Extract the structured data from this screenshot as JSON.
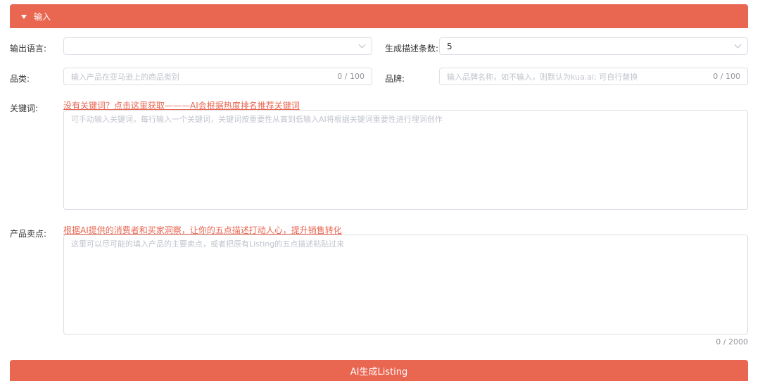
{
  "colors": {
    "accent": "#e96651",
    "border": "#dcdfe6",
    "placeholder": "#c0c4cc"
  },
  "section": {
    "title": "输入",
    "toggle_icon": "caret-down-icon"
  },
  "output_language": {
    "label": "输出语言:",
    "value": "",
    "icon": "chevron-down-icon"
  },
  "description_count": {
    "label": "生成描述条数:",
    "value": "5",
    "icon": "chevron-down-icon"
  },
  "category": {
    "label": "品类:",
    "placeholder": "输入产品在亚马逊上的商品类别",
    "count": "0 / 100"
  },
  "brand": {
    "label": "品牌:",
    "placeholder": "输入品牌名称，如不输入，则默认为kua.ai; 可自行替换",
    "count": "0 / 100"
  },
  "keywords": {
    "label": "关键词:",
    "hint_link": "没有关键词？点击这里获取———AI会根据热度排名推荐关键词",
    "placeholder": "可手动输入关键词，每行输入一个关键词，关键词按重要性从高到低输入AI将根据关键词重要性进行埋词创作"
  },
  "selling_points": {
    "label": "产品卖点:",
    "hint_link": "根据AI提供的消费者和买家洞察，让你的五点描述打动人心，提升销售转化",
    "placeholder": "这里可以尽可能的填入产品的主要卖点，或者把原有Listing的五点描述粘贴过来",
    "count": "0 / 2000"
  },
  "submit": {
    "label": "AI生成Listing"
  }
}
